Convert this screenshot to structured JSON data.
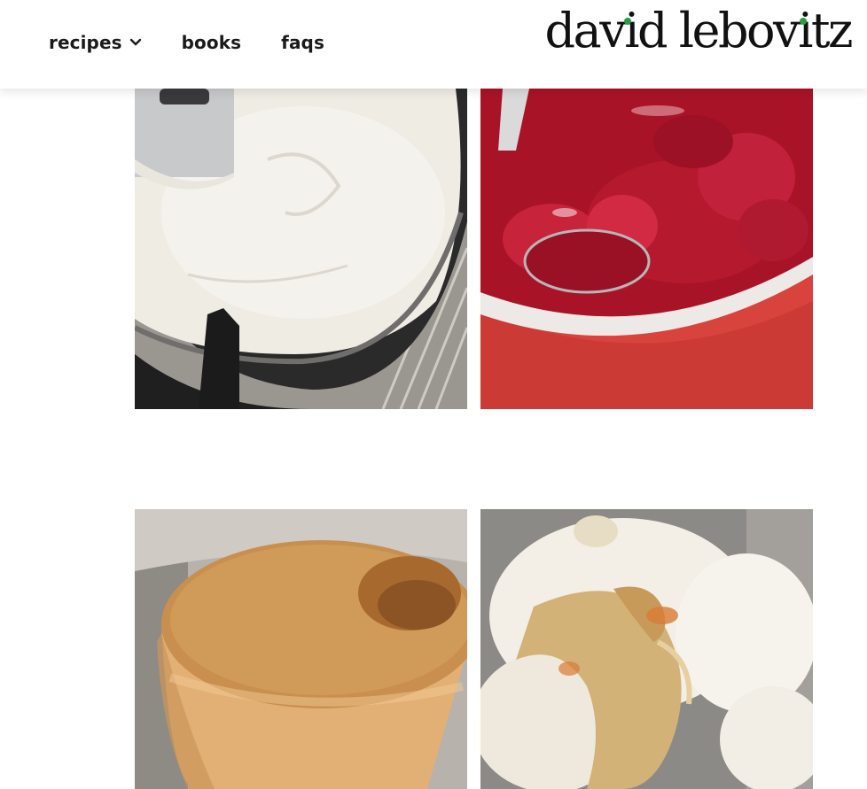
{
  "header": {
    "nav": {
      "recipes": "recipes",
      "books": "books",
      "faqs": "faqs"
    },
    "logo_text": "david lebovitz",
    "logo_dot_color": "#2c9a3f"
  },
  "photos": [
    {
      "name": "cake-batter-in-tube-pan-photo"
    },
    {
      "name": "strawberry-sauce-in-red-pot-photo"
    },
    {
      "name": "angel-food-cake-photo"
    },
    {
      "name": "caramel-swirl-cream-photo"
    }
  ]
}
